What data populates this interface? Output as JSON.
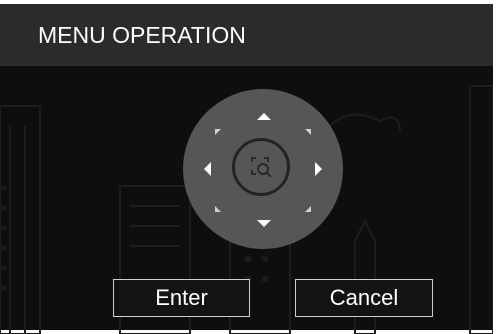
{
  "dialog": {
    "title": "MENU OPERATION",
    "enter_label": "Enter",
    "cancel_label": "Cancel"
  },
  "ptz_pad": {
    "center_icon": "zoom-icon",
    "directions": [
      "up",
      "down",
      "left",
      "right",
      "up-left",
      "up-right",
      "down-left",
      "down-right"
    ]
  },
  "colors": {
    "title_bar": "#2b2b2b",
    "pad": "#565656",
    "background": "#0e0e0e",
    "border": "#ffffff"
  }
}
